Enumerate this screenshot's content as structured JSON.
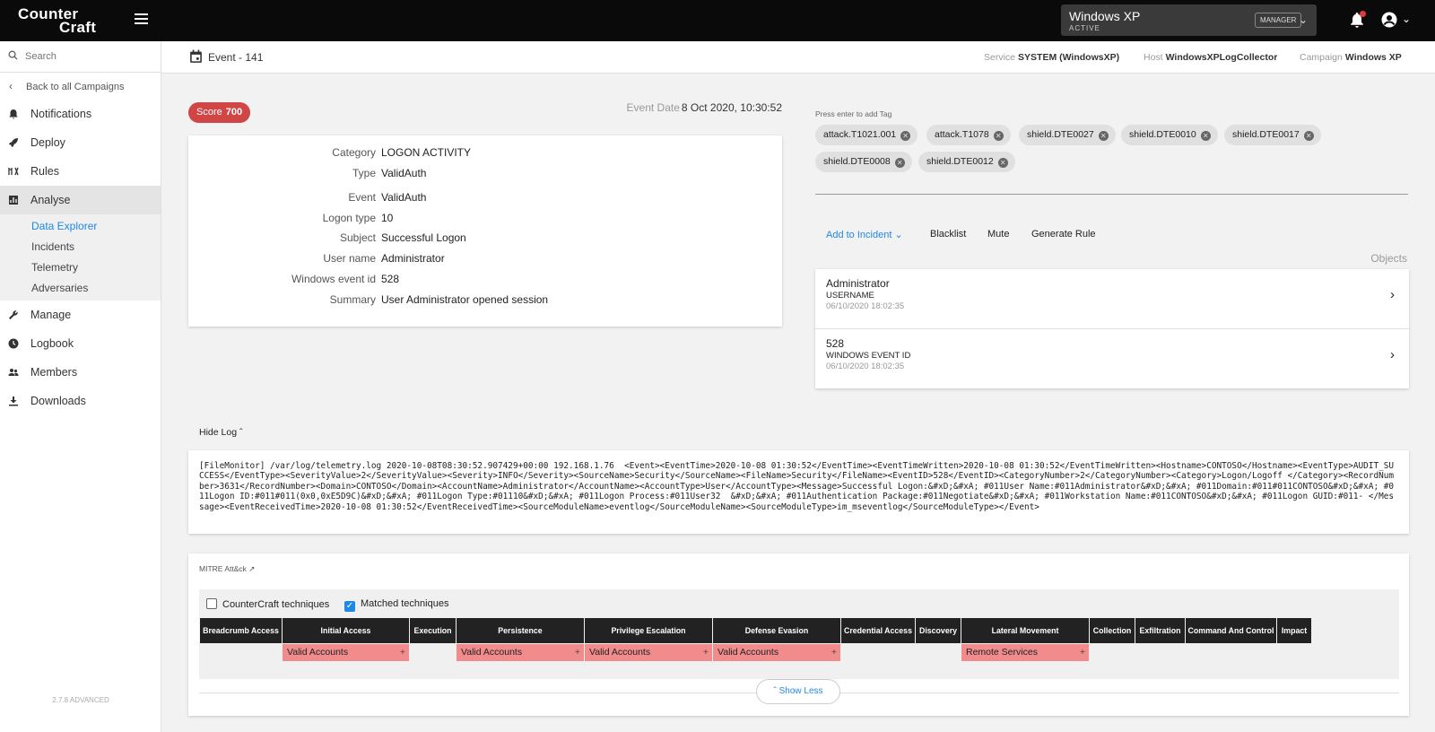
{
  "app": {
    "logo_line1": "Counter",
    "logo_line2": "Craft",
    "version": "2.7.8 ADVANCED"
  },
  "topbar": {
    "campaign_name": "Windows XP",
    "campaign_state": "ACTIVE",
    "role_badge": "MANAGER"
  },
  "sidebar": {
    "search_placeholder": "Search",
    "back_label": "Back to all Campaigns",
    "items": [
      {
        "label": "Notifications"
      },
      {
        "label": "Deploy"
      },
      {
        "label": "Rules"
      },
      {
        "label": "Analyse"
      },
      {
        "label": "Manage"
      },
      {
        "label": "Logbook"
      },
      {
        "label": "Members"
      },
      {
        "label": "Downloads"
      }
    ],
    "analyse_sub": [
      "Data Explorer",
      "Incidents",
      "Telemetry",
      "Adversaries"
    ]
  },
  "header": {
    "title": "Event - 141",
    "service_label": "Service",
    "service_value": "SYSTEM (WindowsXP)",
    "host_label": "Host",
    "host_value": "WindowsXPLogCollector",
    "campaign_label": "Campaign",
    "campaign_value": "Windows XP"
  },
  "event": {
    "score_label": "Score",
    "score_value": "700",
    "date_label": "Event Date",
    "date_value": "8 Oct 2020, 10:30:52",
    "details": [
      {
        "k": "Category",
        "v": "LOGON ACTIVITY"
      },
      {
        "k": "Type",
        "v": "ValidAuth"
      },
      {
        "k": "Event",
        "v": "ValidAuth"
      },
      {
        "k": "Logon type",
        "v": "10"
      },
      {
        "k": "Subject",
        "v": "Successful Logon"
      },
      {
        "k": "User name",
        "v": "Administrator"
      },
      {
        "k": "Windows event id",
        "v": "528"
      },
      {
        "k": "Summary",
        "v": "User Administrator opened session"
      }
    ]
  },
  "tags": {
    "hint": "Press enter to add Tag",
    "items": [
      "attack.T1021.001",
      "attack.T1078",
      "shield.DTE0027",
      "shield.DTE0010",
      "shield.DTE0017",
      "shield.DTE0008",
      "shield.DTE0012"
    ]
  },
  "actions": {
    "add_incident": "Add to Incident",
    "blacklist": "Blacklist",
    "mute": "Mute",
    "generate_rule": "Generate Rule"
  },
  "objects": {
    "label": "Objects",
    "items": [
      {
        "value": "Administrator",
        "kind": "USERNAME",
        "date": "06/10/2020 18:02:35"
      },
      {
        "value": "528",
        "kind": "WINDOWS EVENT ID",
        "date": "06/10/2020 18:02:35"
      }
    ]
  },
  "log": {
    "toggle_label": "Hide Log",
    "text": "[FileMonitor] /var/log/telemetry.log 2020-10-08T08:30:52.907429+00:00 192.168.1.76  <Event><EventTime>2020-10-08 01:30:52</EventTime><EventTimeWritten>2020-10-08 01:30:52</EventTimeWritten><Hostname>CONTOSO</Hostname><EventType>AUDIT_SUCCESS</EventType><SeverityValue>2</SeverityValue><Severity>INFO</Severity><SourceName>Security</SourceName><FileName>Security</FileName><EventID>528</EventID><CategoryNumber>2</CategoryNumber><Category>Logon/Logoff </Category><RecordNumber>3631</RecordNumber><Domain>CONTOSO</Domain><AccountName>Administrator</AccountName><AccountType>User</AccountType><Message>Successful Logon:&#xD;&#xA; #011User Name:#011Administrator&#xD;&#xA; #011Domain:#011#011CONTOSO&#xD;&#xA; #011Logon ID:#011#011(0x0,0xE5D9C)&#xD;&#xA; #011Logon Type:#01110&#xD;&#xA; #011Logon Process:#011User32  &#xD;&#xA; #011Authentication Package:#011Negotiate&#xD;&#xA; #011Workstation Name:#011CONTOSO&#xD;&#xA; #011Logon GUID:#011- </Message><EventReceivedTime>2020-10-08 01:30:52</EventReceivedTime><SourceModuleName>eventlog</SourceModuleName><SourceModuleType>im_mseventlog</SourceModuleType></Event>"
  },
  "mitre": {
    "title": "MITRE Att&ck",
    "chk_countercraft": "CounterCraft techniques",
    "chk_countercraft_checked": false,
    "chk_matched": "Matched techniques",
    "chk_matched_checked": true,
    "tactics": [
      "Breadcrumb Access",
      "Initial Access",
      "Execution",
      "Persistence",
      "Privilege Escalation",
      "Defense Evasion",
      "Credential Access",
      "Discovery",
      "Lateral Movement",
      "Collection",
      "Exfiltration",
      "Command And Control",
      "Impact"
    ],
    "techniques": [
      {
        "tactic": "Initial Access",
        "label": "Valid Accounts"
      },
      {
        "tactic": "Persistence",
        "label": "Valid Accounts"
      },
      {
        "tactic": "Privilege Escalation",
        "label": "Valid Accounts"
      },
      {
        "tactic": "Defense Evasion",
        "label": "Valid Accounts"
      },
      {
        "tactic": "Lateral Movement",
        "label": "Remote Services"
      }
    ],
    "show_less": "Show Less"
  },
  "colors": {
    "accent": "#1e88e5",
    "score": "#d04545",
    "technique": "#f28b8b",
    "topbar": "#0a0a0a"
  }
}
